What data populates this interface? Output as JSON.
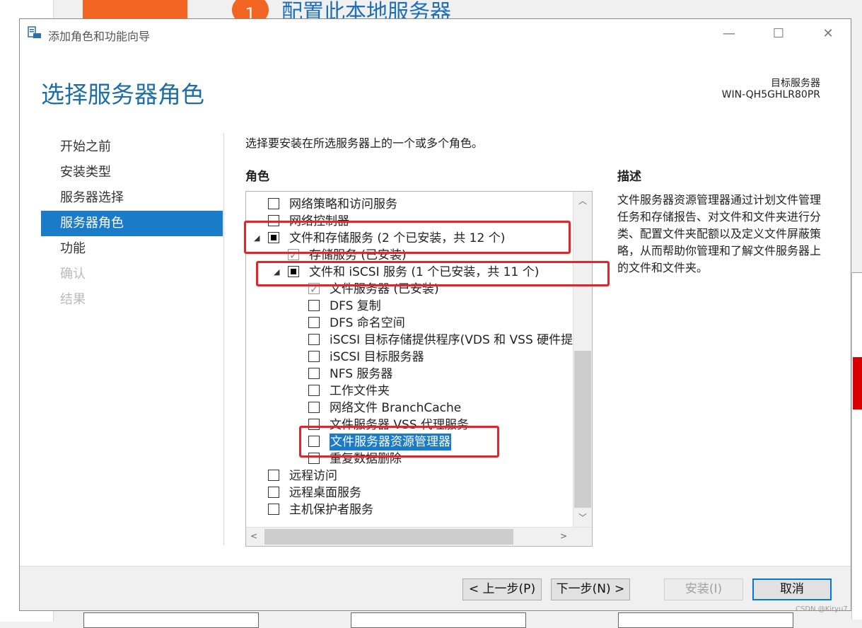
{
  "background": {
    "step_number": "1",
    "step_title": "配置此本地服务器",
    "watermark": "CSDN @Kiryu7"
  },
  "window": {
    "title": "添加角色和功能向导",
    "controls": {
      "minimize": "—",
      "maximize": "☐",
      "close": "✕"
    }
  },
  "header": {
    "page_title": "选择服务器角色",
    "target_label": "目标服务器",
    "target_name": "WIN-QH5GHLR80PR"
  },
  "nav": {
    "items": [
      {
        "label": "开始之前",
        "state": "normal"
      },
      {
        "label": "安装类型",
        "state": "normal"
      },
      {
        "label": "服务器选择",
        "state": "normal"
      },
      {
        "label": "服务器角色",
        "state": "active"
      },
      {
        "label": "功能",
        "state": "normal"
      },
      {
        "label": "确认",
        "state": "disabled"
      },
      {
        "label": "结果",
        "state": "disabled"
      }
    ]
  },
  "main": {
    "instruction": "选择要安装在所选服务器上的一个或多个角色。",
    "roles_header": "角色",
    "description_header": "描述",
    "description_text": "文件服务器资源管理器通过计划文件管理任务和存储报告、对文件和文件夹进行分类、配置文件夹配额以及定义文件屏蔽策略，从而帮助你管理和了解文件服务器上的文件和文件夹。",
    "roles": [
      {
        "label": "网络策略和访问服务",
        "level": 0,
        "state": "unchecked"
      },
      {
        "label": "网络控制器",
        "level": 0,
        "state": "unchecked"
      },
      {
        "label": "文件和存储服务 (2 个已安装，共 12 个)",
        "level": 0,
        "state": "partial",
        "expanded": true
      },
      {
        "label": "存储服务 (已安装)",
        "level": 1,
        "state": "checked"
      },
      {
        "label": "文件和 iSCSI 服务 (1 个已安装，共 11 个)",
        "level": 1,
        "state": "partial",
        "expanded": true
      },
      {
        "label": "文件服务器 (已安装)",
        "level": 2,
        "state": "checked"
      },
      {
        "label": "DFS 复制",
        "level": 2,
        "state": "unchecked"
      },
      {
        "label": "DFS 命名空间",
        "level": 2,
        "state": "unchecked"
      },
      {
        "label": "iSCSI 目标存储提供程序(VDS 和 VSS 硬件提供程序)",
        "level": 2,
        "state": "unchecked"
      },
      {
        "label": "iSCSI 目标服务器",
        "level": 2,
        "state": "unchecked"
      },
      {
        "label": "NFS 服务器",
        "level": 2,
        "state": "unchecked"
      },
      {
        "label": "工作文件夹",
        "level": 2,
        "state": "unchecked"
      },
      {
        "label": "网络文件 BranchCache",
        "level": 2,
        "state": "unchecked"
      },
      {
        "label": "文件服务器 VSS 代理服务",
        "level": 2,
        "state": "unchecked"
      },
      {
        "label": "文件服务器资源管理器",
        "level": 2,
        "state": "unchecked",
        "selected": true
      },
      {
        "label": "重复数据删除",
        "level": 2,
        "state": "unchecked"
      },
      {
        "label": "远程访问",
        "level": 0,
        "state": "unchecked"
      },
      {
        "label": "远程桌面服务",
        "level": 0,
        "state": "unchecked"
      },
      {
        "label": "主机保护者服务",
        "level": 0,
        "state": "unchecked"
      }
    ]
  },
  "footer": {
    "prev": "< 上一步(P)",
    "next": "下一步(N) >",
    "install": "安装(I)",
    "cancel": "取消"
  },
  "colors": {
    "accent": "#1a7bc9",
    "highlight": "#e4242a",
    "title": "#1c6ea4"
  }
}
